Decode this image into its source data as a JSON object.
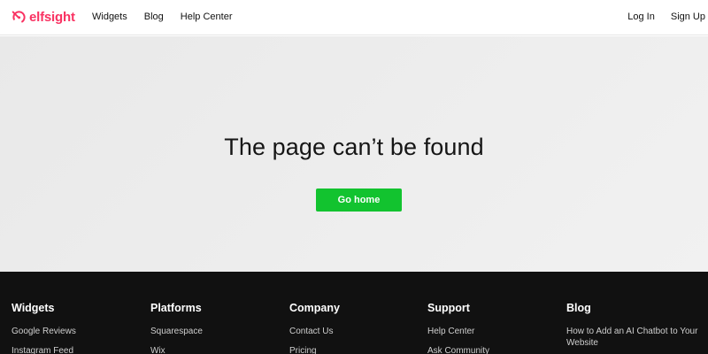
{
  "header": {
    "logo_text": "elfsight",
    "nav": [
      "Widgets",
      "Blog",
      "Help Center"
    ],
    "login": "Log In",
    "signup": "Sign Up"
  },
  "main": {
    "title": "The page can’t be found",
    "button": "Go home"
  },
  "footer": {
    "columns": [
      {
        "title": "Widgets",
        "links": [
          "Google Reviews",
          "Instagram Feed"
        ]
      },
      {
        "title": "Platforms",
        "links": [
          "Squarespace",
          "Wix"
        ]
      },
      {
        "title": "Company",
        "links": [
          "Contact Us",
          "Pricing"
        ]
      },
      {
        "title": "Support",
        "links": [
          "Help Center",
          "Ask Community"
        ]
      },
      {
        "title": "Blog",
        "links": [
          "How to Add an AI Chatbot to Your Website"
        ]
      }
    ]
  },
  "colors": {
    "brand": "#f93262",
    "button": "#12c32f",
    "footer_bg": "#111111"
  },
  "icons": {
    "logo": "elfsight-logo-icon"
  }
}
